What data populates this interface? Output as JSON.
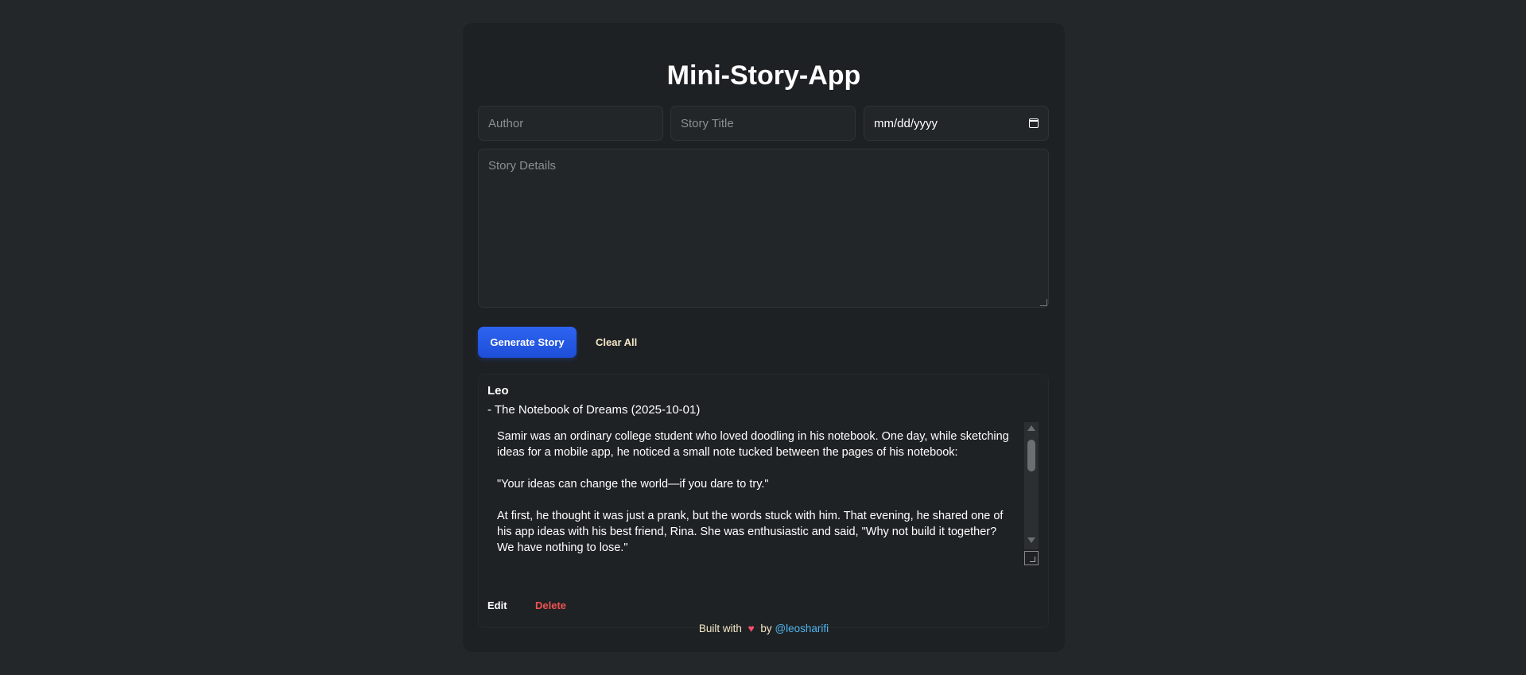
{
  "app": {
    "title": "Mini-Story-App"
  },
  "form": {
    "author_placeholder": "Author",
    "title_placeholder": "Story Title",
    "date_placeholder": "mm/dd/yyyy",
    "details_placeholder": "Story Details"
  },
  "actions": {
    "generate_label": "Generate Story",
    "clear_label": "Clear All"
  },
  "story": {
    "author": "Leo",
    "meta": "- The Notebook of Dreams (2025-10-01)",
    "body": "Samir was an ordinary college student who loved doodling in his notebook. One day, while sketching ideas for a mobile app, he noticed a small note tucked between the pages of his notebook:\n\n\"Your ideas can change the world—if you dare to try.\"\n\nAt first, he thought it was just a prank, but the words stuck with him. That evening, he shared one of his app ideas with his best friend, Rina. She was enthusiastic and said, \"Why not build it together? We have nothing to lose.\"",
    "edit_label": "Edit",
    "delete_label": "Delete"
  },
  "footer": {
    "built_with": "Built with",
    "heart": "♥",
    "by": "by",
    "handle": "@leosharifi"
  },
  "colors": {
    "background": "#232729",
    "card": "#1e2123",
    "accent_button": "#1d4ed8",
    "delete": "#f05252",
    "link": "#4fb4f0"
  }
}
